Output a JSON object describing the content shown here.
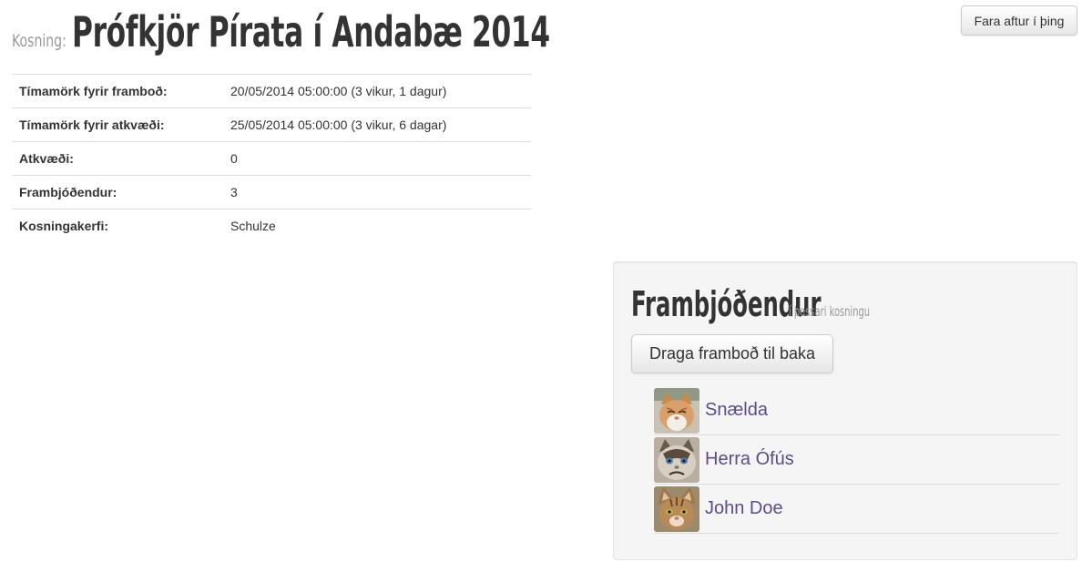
{
  "header": {
    "kosning_label": "Kosning:",
    "title": "Prófkjör Pírata í Andabæ 2014",
    "back_button_label": "Fara aftur í þing"
  },
  "info_rows": [
    {
      "key": "Tímamörk fyrir framboð:",
      "value": "20/05/2014 05:00:00 (3 vikur, 1 dagur)"
    },
    {
      "key": "Tímamörk fyrir atkvæði:",
      "value": "25/05/2014 05:00:00 (3 vikur, 6 dagar)"
    },
    {
      "key": "Atkvæði:",
      "value": "0"
    },
    {
      "key": "Frambjóðendur:",
      "value": "3"
    },
    {
      "key": "Kosningakerfi:",
      "value": "Schulze"
    }
  ],
  "candidates_panel": {
    "title": "Frambjóðendur",
    "subtitle": "í þessari kosningu",
    "withdraw_button_label": "Draga framboð til baka",
    "candidates": [
      {
        "name": "Snælda",
        "avatar": "ginger-cat-photo"
      },
      {
        "name": "Herra Ófús",
        "avatar": "grumpy-cat-photo"
      },
      {
        "name": "John Doe",
        "avatar": "tabby-cat-photo"
      }
    ]
  },
  "colors": {
    "link": "#5e4c8a",
    "muted": "#999999",
    "text": "#333333",
    "panel_bg": "#f5f5f5"
  }
}
